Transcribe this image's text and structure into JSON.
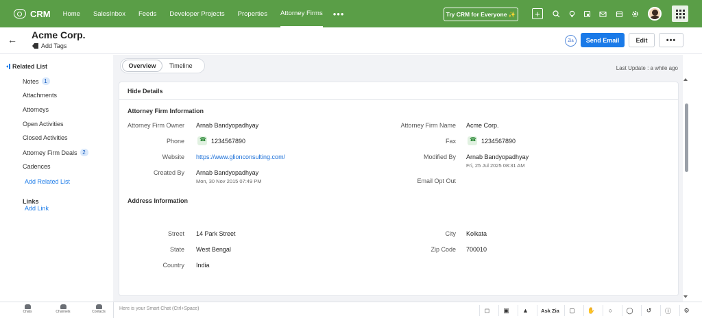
{
  "nav": {
    "brand": "CRM",
    "items": [
      "Home",
      "SalesInbox",
      "Feeds",
      "Developer Projects",
      "Properties",
      "Attorney Firms"
    ],
    "active_index": 5,
    "more": "•••",
    "try_button": "Try CRM for Everyone ✨",
    "icons": [
      "plus-icon",
      "search-icon",
      "bulb-icon",
      "bell-icon",
      "calendar-icon",
      "mail-icon",
      "store-icon",
      "gear-icon",
      "avatar",
      "app-grid-icon"
    ]
  },
  "record": {
    "title": "Acme Corp.",
    "add_tags": "Add Tags",
    "zia_label": "Zia",
    "send_email": "Send Email",
    "edit": "Edit",
    "more": "•••"
  },
  "sidebar": {
    "header": "Related List",
    "items": [
      {
        "label": "Notes",
        "count": "1"
      },
      {
        "label": "Attachments",
        "count": ""
      },
      {
        "label": "Attorneys",
        "count": ""
      },
      {
        "label": "Open Activities",
        "count": ""
      },
      {
        "label": "Closed Activities",
        "count": ""
      },
      {
        "label": "Attorney Firm Deals",
        "count": "2"
      },
      {
        "label": "Cadences",
        "count": ""
      }
    ],
    "add_related": "Add Related List",
    "links_header": "Links",
    "add_link": "Add Link"
  },
  "tabs": {
    "overview": "Overview",
    "timeline": "Timeline"
  },
  "last_update": "Last Update : a while ago",
  "details": {
    "hide_details": "Hide Details",
    "firm_section": "Attorney Firm Information",
    "firm_owner_label": "Attorney Firm Owner",
    "firm_owner": "Arnab Bandyopadhyay",
    "phone_label": "Phone",
    "phone": "1234567890",
    "website_label": "Website",
    "website": "https://www.glionconsulting.com/",
    "created_by_label": "Created By",
    "created_by": "Arnab Bandyopadhyay",
    "created_at": "Mon, 30 Nov 2015 07:49 PM",
    "firm_name_label": "Attorney Firm Name",
    "firm_name": "Acme Corp.",
    "fax_label": "Fax",
    "fax": "1234567890",
    "modified_by_label": "Modified By",
    "modified_by": "Arnab Bandyopadhyay",
    "modified_at": "Fri, 25 Jul 2025 08:31 AM",
    "email_opt_out_label": "Email Opt Out",
    "address_section": "Address Information",
    "street_label": "Street",
    "street": "14 Park Street",
    "state_label": "State",
    "state": "West Bengal",
    "country_label": "Country",
    "country": "India",
    "city_label": "City",
    "city": "Kolkata",
    "zip_label": "Zip Code",
    "zip": "700010"
  },
  "bottom": {
    "chats": "Chats",
    "channels": "Channels",
    "contacts": "Contacts",
    "smart_chat": "Here is your Smart Chat (Ctrl+Space)",
    "ask_zia": "Ask Zia"
  }
}
